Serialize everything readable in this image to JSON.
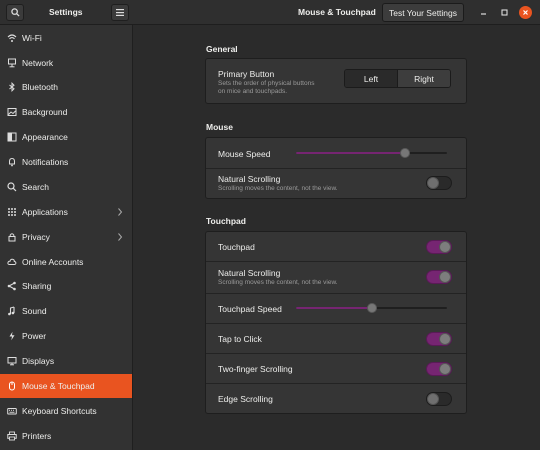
{
  "header": {
    "app_title": "Settings",
    "panel_title": "Mouse & Touchpad",
    "test_button_label": "Test Your Settings"
  },
  "sidebar": {
    "items": [
      {
        "label": "Wi-Fi",
        "icon": "wifi-icon"
      },
      {
        "label": "Network",
        "icon": "network-icon"
      },
      {
        "label": "Bluetooth",
        "icon": "bluetooth-icon"
      },
      {
        "label": "Background",
        "icon": "background-icon"
      },
      {
        "label": "Appearance",
        "icon": "appearance-icon"
      },
      {
        "label": "Notifications",
        "icon": "bell-icon"
      },
      {
        "label": "Search",
        "icon": "search-icon"
      },
      {
        "label": "Applications",
        "icon": "apps-icon",
        "chevron": true
      },
      {
        "label": "Privacy",
        "icon": "privacy-icon",
        "chevron": true
      },
      {
        "label": "Online Accounts",
        "icon": "cloud-icon"
      },
      {
        "label": "Sharing",
        "icon": "share-icon"
      },
      {
        "label": "Sound",
        "icon": "sound-icon"
      },
      {
        "label": "Power",
        "icon": "power-icon"
      },
      {
        "label": "Displays",
        "icon": "display-icon"
      },
      {
        "label": "Mouse & Touchpad",
        "icon": "mouse-icon",
        "active": true
      },
      {
        "label": "Keyboard Shortcuts",
        "icon": "keyboard-icon"
      },
      {
        "label": "Printers",
        "icon": "printer-icon"
      }
    ]
  },
  "general": {
    "title": "General",
    "primary_button": {
      "label": "Primary Button",
      "description_line1": "Sets the order of physical buttons",
      "description_line2": "on mice and touchpads.",
      "left_label": "Left",
      "right_label": "Right",
      "selected": "Right"
    }
  },
  "mouse": {
    "title": "Mouse",
    "speed_label": "Mouse Speed",
    "speed_value": 0.72,
    "natural_scrolling_label": "Natural Scrolling",
    "natural_scrolling_desc": "Scrolling moves the content, not the view.",
    "natural_scrolling_on": false
  },
  "touchpad": {
    "title": "Touchpad",
    "touchpad_label": "Touchpad",
    "touchpad_on": true,
    "natural_scrolling_label": "Natural Scrolling",
    "natural_scrolling_desc": "Scrolling moves the content, not the view.",
    "natural_scrolling_on": true,
    "speed_label": "Touchpad Speed",
    "speed_value": 0.5,
    "tap_to_click_label": "Tap to Click",
    "tap_to_click_on": true,
    "two_finger_label": "Two-finger Scrolling",
    "two_finger_on": true,
    "edge_scrolling_label": "Edge Scrolling",
    "edge_scrolling_on": false
  },
  "colors": {
    "accent": "#e95420",
    "switch_on": "#762572"
  }
}
